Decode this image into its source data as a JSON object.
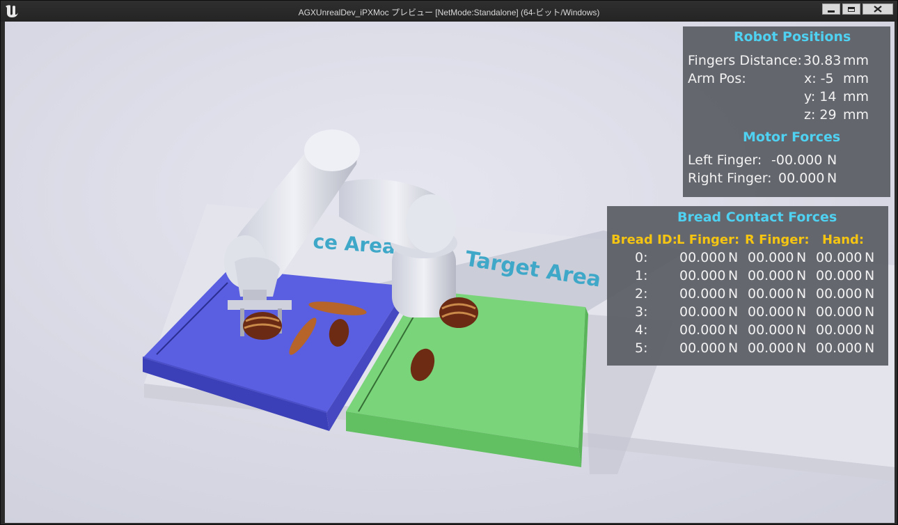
{
  "window": {
    "title": "AGXUnrealDev_iPXMoc プレビュー [NetMode:Standalone] (64-ビット/Windows)",
    "icons": {
      "logo": "unreal-logo",
      "minimize": "minimize-icon",
      "maximize": "maximize-icon",
      "close": "close-icon"
    }
  },
  "scene": {
    "source_area_label": "ce Area",
    "target_area_label": "Target Area",
    "colors": {
      "source_tray": "#5c60dd",
      "target_tray": "#7cd87c",
      "label": "#3fa8c8"
    }
  },
  "robot_positions": {
    "title": "Robot Positions",
    "fingers_distance_label": "Fingers Distance:",
    "fingers_distance_value": "30.83",
    "arm_pos_label": "Arm Pos:",
    "unit": "mm",
    "x": "x: -5",
    "y": "y: 14",
    "z": "z: 29"
  },
  "motor_forces": {
    "title": "Motor Forces",
    "left_label": "Left Finger:",
    "left_value": "-00.000",
    "right_label": "Right Finger:",
    "right_value": "00.000",
    "unit": "N"
  },
  "bread_contact": {
    "title": "Bread Contact Forces",
    "headers": [
      "Bread ID:",
      "L Finger:",
      "R Finger:",
      "Hand:"
    ],
    "unit": "N",
    "rows": [
      {
        "id": "0:",
        "l": "00.000",
        "r": "00.000",
        "h": "00.000"
      },
      {
        "id": "1:",
        "l": "00.000",
        "r": "00.000",
        "h": "00.000"
      },
      {
        "id": "2:",
        "l": "00.000",
        "r": "00.000",
        "h": "00.000"
      },
      {
        "id": "3:",
        "l": "00.000",
        "r": "00.000",
        "h": "00.000"
      },
      {
        "id": "4:",
        "l": "00.000",
        "r": "00.000",
        "h": "00.000"
      },
      {
        "id": "5:",
        "l": "00.000",
        "r": "00.000",
        "h": "00.000"
      }
    ]
  }
}
